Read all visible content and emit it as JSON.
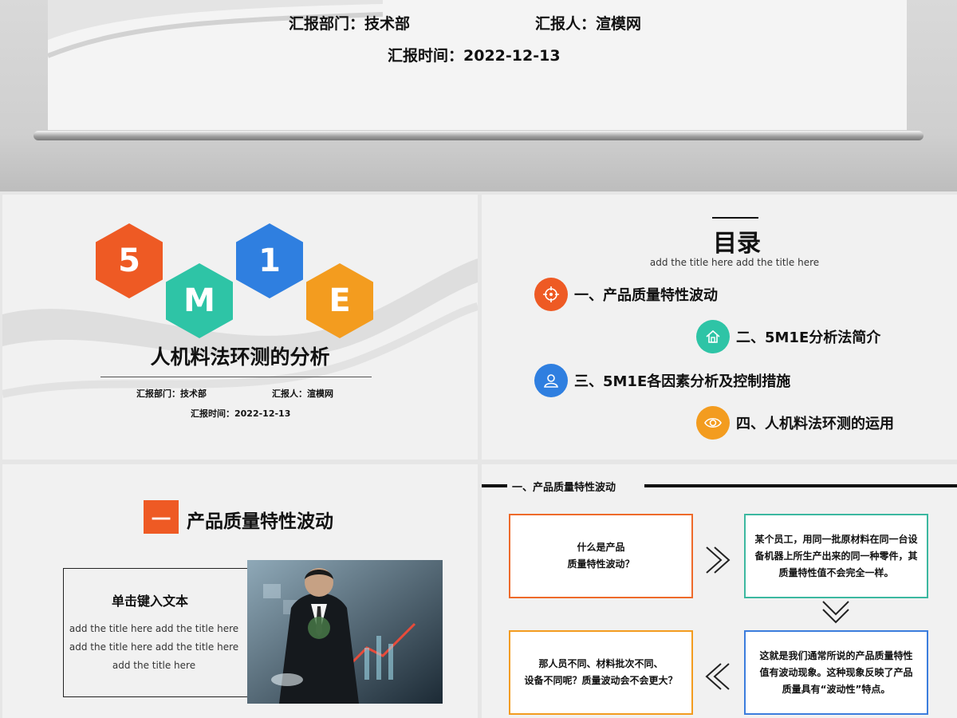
{
  "top_slide": {
    "department": "汇报部门：技术部",
    "reporter": "汇报人：渲模网",
    "date": "汇报时间：2022-12-13"
  },
  "cover_slide": {
    "hexagons": [
      {
        "label": "5",
        "color": "#ee5a24"
      },
      {
        "label": "M",
        "color": "#2ec4a6"
      },
      {
        "label": "1",
        "color": "#2f7fe0"
      },
      {
        "label": "E",
        "color": "#f39c1f"
      }
    ],
    "title": "人机料法环测的分析",
    "department": "汇报部门：技术部",
    "reporter": "汇报人：渲模网",
    "date": "汇报时间：2022-12-13"
  },
  "toc_slide": {
    "title": "目录",
    "subtitle": "add the title here add the title here",
    "items": [
      {
        "label": "一、产品质量特性波动",
        "icon": "target-icon",
        "color": "#ee5a24"
      },
      {
        "label": "二、5M1E分析法简介",
        "icon": "home-icon",
        "color": "#2ec4a6"
      },
      {
        "label": "三、5M1E各因素分析及控制措施",
        "icon": "user-icon",
        "color": "#2f7fe0"
      },
      {
        "label": "四、人机料法环测的运用",
        "icon": "eye-icon",
        "color": "#f39c1f"
      }
    ]
  },
  "section_slide": {
    "number": "一",
    "title": "产品质量特性波动",
    "box_title": "单击键入文本",
    "box_text": [
      "add the title here add the title here",
      "add the title here add the title here",
      "add the title here"
    ]
  },
  "detail_slide": {
    "header": "一、产品质量特性波动",
    "boxes": [
      {
        "lines": [
          "什么是产品",
          "质量特性波动？"
        ],
        "color": "#ee6a2a"
      },
      {
        "lines": [
          "某个员工，用同一批原材料在同一台设",
          "备机器上所生产出来的同一种零件，其",
          "质量特性值不会完全一样。"
        ],
        "color": "#3cb8a0"
      },
      {
        "lines": [
          "那人员不同、材料批次不同、",
          "设备不同呢？质量波动会不会更大？"
        ],
        "color": "#f39c1f"
      },
      {
        "lines": [
          "这就是我们通常所说的产品质量特性",
          "值有波动现象。这种现象反映了产品",
          "质量具有“波动性”特点。"
        ],
        "color": "#3b7ddd"
      }
    ]
  }
}
